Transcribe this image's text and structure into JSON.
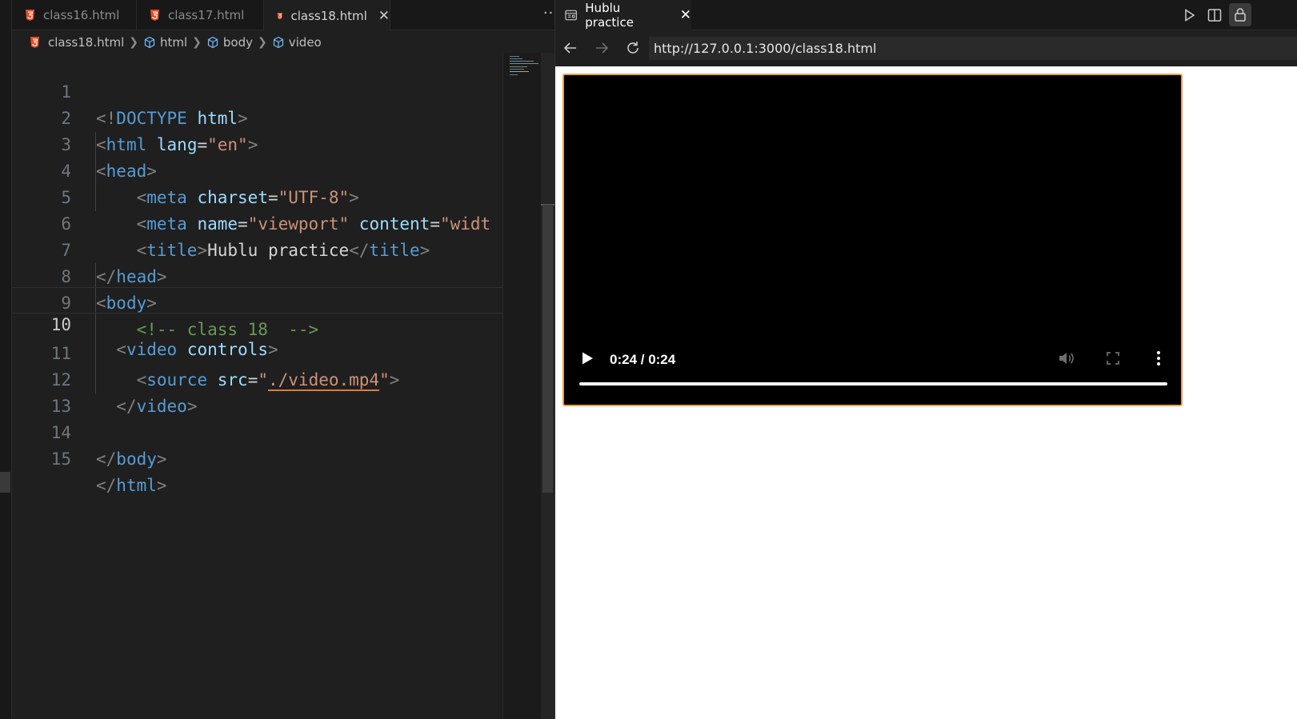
{
  "editor": {
    "tabs": [
      {
        "label": "class16.html",
        "active": false
      },
      {
        "label": "class17.html",
        "active": false
      },
      {
        "label": "class18.html",
        "active": true
      }
    ],
    "more_label": "···",
    "breadcrumb": [
      "class18.html",
      "html",
      "body",
      "video"
    ],
    "current_line": 10,
    "lines": [
      {
        "n": "1"
      },
      {
        "n": "2"
      },
      {
        "n": "3"
      },
      {
        "n": "4"
      },
      {
        "n": "5"
      },
      {
        "n": "6"
      },
      {
        "n": "7"
      },
      {
        "n": "8"
      },
      {
        "n": "9"
      },
      {
        "n": "10"
      },
      {
        "n": "11"
      },
      {
        "n": "12"
      },
      {
        "n": "13"
      },
      {
        "n": "14"
      },
      {
        "n": "15"
      }
    ],
    "code": {
      "l1": {
        "open": "<!",
        "tag": "DOCTYPE",
        "attr": "html",
        "close": ">"
      },
      "l2": {
        "tag": "html",
        "attr": "lang",
        "val": "\"en\""
      },
      "l3": {
        "tag": "head"
      },
      "l4": {
        "tag": "meta",
        "attr": "charset",
        "val": "\"UTF-8\""
      },
      "l5": {
        "tag": "meta",
        "attr1": "name",
        "val1": "\"viewport\"",
        "attr2": "content",
        "val2": "\"widt"
      },
      "l6": {
        "tag": "title",
        "text": "Hublu practice"
      },
      "l7": {
        "tag": "head"
      },
      "l8": {
        "tag": "body"
      },
      "l9": {
        "comment": "<!-- class 18  -->"
      },
      "l10": {
        "tag": "video",
        "attr": "controls"
      },
      "l11": {
        "tag": "source",
        "attr": "src",
        "val": "./video.mp4"
      },
      "l12": {
        "tag": "video"
      },
      "l14": {
        "tag": "body"
      },
      "l15": {
        "tag": "html"
      }
    }
  },
  "browser": {
    "tab_title": "Hublu practice",
    "url": "http://127.0.0.1:3000/class18.html",
    "video": {
      "time": "0:24 / 0:24",
      "progress": 1.0
    }
  },
  "colors": {
    "tag": "#569cd6",
    "attribute": "#9cdcfe",
    "string": "#ce9178",
    "comment": "#6a9955",
    "punctuation": "#808080",
    "video_border": "#e8a33c"
  }
}
